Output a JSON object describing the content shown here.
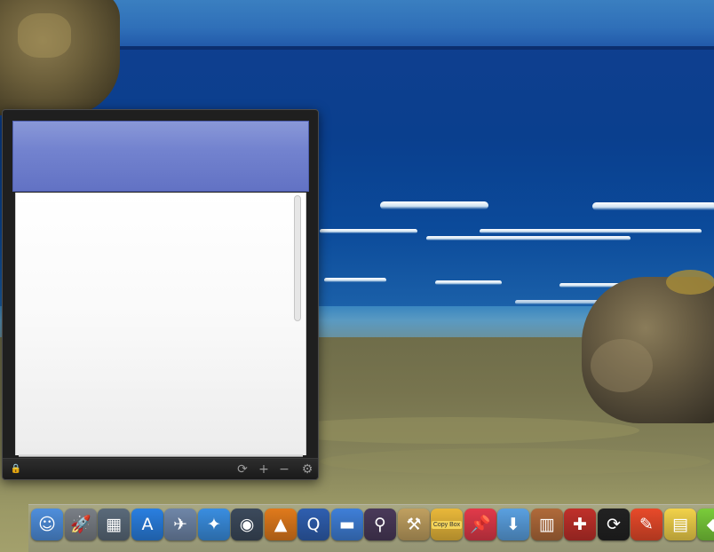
{
  "desktop": {
    "wallpaper": "beach-ocean-scene"
  },
  "panel": {
    "header_color": "#7383cf",
    "toolbar": {
      "lock_icon": "lock-icon",
      "buttons": [
        {
          "name": "history-button",
          "icon": "circle-arrow-icon",
          "glyph": "⟳"
        },
        {
          "name": "add-button",
          "icon": "plus-icon",
          "glyph": "+"
        },
        {
          "name": "remove-button",
          "icon": "minus-icon",
          "glyph": "−"
        },
        {
          "name": "settings-button",
          "icon": "gear-icon",
          "glyph": "⚙"
        }
      ]
    }
  },
  "dock": {
    "items": [
      {
        "name": "finder",
        "icon": "finder-icon",
        "glyph": "☺",
        "color": "#4f8fdc"
      },
      {
        "name": "launchpad",
        "icon": "rocket-icon",
        "glyph": "🚀",
        "color": "#7a7f86"
      },
      {
        "name": "mission-control",
        "icon": "windows-icon",
        "glyph": "▦",
        "color": "#5a6a7a"
      },
      {
        "name": "app-store",
        "icon": "app-store-icon",
        "glyph": "A",
        "color": "#2a7fe0"
      },
      {
        "name": "preview",
        "icon": "eagle-icon",
        "glyph": "✈",
        "color": "#6f86a8"
      },
      {
        "name": "safari",
        "icon": "compass-icon",
        "glyph": "✦",
        "color": "#3a8ee0"
      },
      {
        "name": "facetime",
        "icon": "camera-icon",
        "glyph": "◉",
        "color": "#3c4a5c"
      },
      {
        "name": "vlc",
        "icon": "traffic-cone-icon",
        "glyph": "▲",
        "color": "#e07a1c"
      },
      {
        "name": "quicktime",
        "icon": "quicktime-icon",
        "glyph": "Q",
        "color": "#2f5fb0"
      },
      {
        "name": "toggle-app",
        "icon": "toggle-icon",
        "glyph": "▬",
        "color": "#3f7fd8"
      },
      {
        "name": "alfred",
        "icon": "magnifier-hat-icon",
        "glyph": "⚲",
        "color": "#4a3a5a"
      },
      {
        "name": "app-utility",
        "icon": "tools-icon",
        "glyph": "⚒",
        "color": "#c0a060"
      },
      {
        "name": "copy-box",
        "icon": "copy-box-icon",
        "label": "Copy Box",
        "color": "#e9b83a"
      },
      {
        "name": "pin-app",
        "icon": "pushpin-icon",
        "glyph": "📌",
        "color": "#e23a4a"
      },
      {
        "name": "downloads",
        "icon": "download-arrow-icon",
        "glyph": "⬇",
        "color": "#5aa0e0"
      },
      {
        "name": "book-app",
        "icon": "book-icon",
        "glyph": "▥",
        "color": "#b06a3a"
      },
      {
        "name": "toolbox-app",
        "icon": "toolbox-icon",
        "glyph": "✚",
        "color": "#c0302a"
      },
      {
        "name": "sync-app",
        "icon": "sync-icon",
        "glyph": "⟳",
        "color": "#222222"
      },
      {
        "name": "notes-app",
        "icon": "notepad-icon",
        "glyph": "✎",
        "color": "#e84a2a"
      },
      {
        "name": "stickies",
        "icon": "sticky-note-icon",
        "glyph": "▤",
        "color": "#f2d24a"
      },
      {
        "name": "green-app",
        "icon": "green-app-icon",
        "glyph": "◆",
        "color": "#7acc3a"
      }
    ]
  }
}
